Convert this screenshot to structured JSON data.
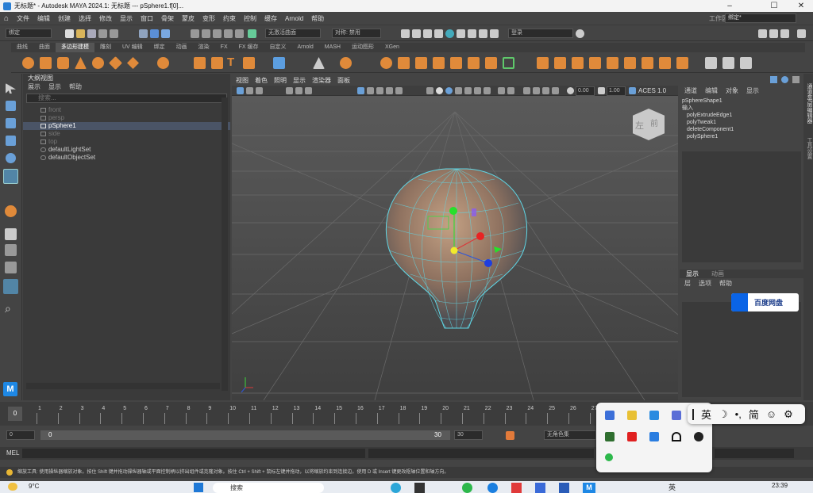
{
  "window": {
    "title": "无标题* - Autodesk MAYA 2024.1: 无标题   ---   pSphere1.f[0]...",
    "workspace_label": "工作区:",
    "workspace_value": "绑定*"
  },
  "menus": [
    "文件",
    "编辑",
    "创建",
    "选择",
    "修改",
    "显示",
    "窗口",
    "骨架",
    "蒙皮",
    "变形",
    "约束",
    "控制",
    "缓存",
    "Arnold",
    "帮助"
  ],
  "status": {
    "mode": "绑定",
    "no_live": "无激活曲面",
    "symmetry_label": "对称: 禁用",
    "login": "登录"
  },
  "shelf_tabs": [
    "曲线",
    "曲面",
    "多边形建模",
    "雕刻",
    "UV 编辑",
    "绑定",
    "动画",
    "渲染",
    "FX",
    "FX 缓存",
    "自定义",
    "Arnold",
    "MASH",
    "运动图形",
    "XGen"
  ],
  "shelf_active": 2,
  "outliner": {
    "title": "大纲视图",
    "menu": [
      "展示",
      "显示",
      "帮助"
    ],
    "search_placeholder": "搜索...",
    "items": [
      {
        "label": "front",
        "dim": true
      },
      {
        "label": "persp",
        "dim": true
      },
      {
        "label": "pSphere1",
        "dim": false,
        "selected": true
      },
      {
        "label": "side",
        "dim": true
      },
      {
        "label": "top",
        "dim": true
      },
      {
        "label": "defaultLightSet",
        "dim": false
      },
      {
        "label": "defaultObjectSet",
        "dim": false
      }
    ]
  },
  "viewport": {
    "menu": [
      "视图",
      "着色",
      "照明",
      "显示",
      "渲染器",
      "面板"
    ],
    "exposure": "0.00",
    "gamma": "1.00",
    "colorspace": "ACES 1.0",
    "cube_left": "左",
    "cube_front": "前"
  },
  "channel_box": {
    "menu": [
      "通道",
      "编辑",
      "对象",
      "显示"
    ],
    "shape": "pSphereShape1",
    "inputs_label": "输入",
    "inputs": [
      "polyExtrudeEdge1",
      "polyTweak1",
      "deleteComponent1",
      "polySphere1"
    ],
    "layer_tabs": [
      "显示",
      "动画"
    ],
    "layer_menu": [
      "层",
      "选项",
      "帮助"
    ],
    "side_tabs": [
      "通道盒/层编辑器",
      "工具设置"
    ]
  },
  "timeline": {
    "ticks": [
      "0",
      "1",
      "2",
      "3",
      "4",
      "5",
      "6",
      "7",
      "8",
      "9",
      "10",
      "11",
      "12",
      "13",
      "14",
      "15",
      "16",
      "17",
      "18",
      "19",
      "20",
      "21",
      "22",
      "23",
      "24",
      "25",
      "26",
      "27"
    ],
    "current": "0"
  },
  "range": {
    "start": "0",
    "inner_start": "0",
    "inner_end": "30",
    "end": "30",
    "character": "无角色集"
  },
  "cmd": {
    "label": "MEL"
  },
  "help": "缩放工具: 使用操纵器缩放对象。按住 Shift 键并拖动操纵器轴或平面控制柄以挤出组件或克隆对象。按住 Ctrl + Shift + 鼠标左键并拖动，以将缩放约束到连接边。使用 D 或 Insert 键更改枢轴位置和轴方向。",
  "baidu": {
    "label": "百度网盘"
  },
  "ime": {
    "lang": "英",
    "mode": "简"
  },
  "taskbar": {
    "weather": "9°C",
    "search": "搜索",
    "lang": "英",
    "clock": "23:39"
  },
  "colors": {
    "wire": "#5fd7e6",
    "mesh_orange": "#a07a5c",
    "accent": "#5285a6"
  }
}
